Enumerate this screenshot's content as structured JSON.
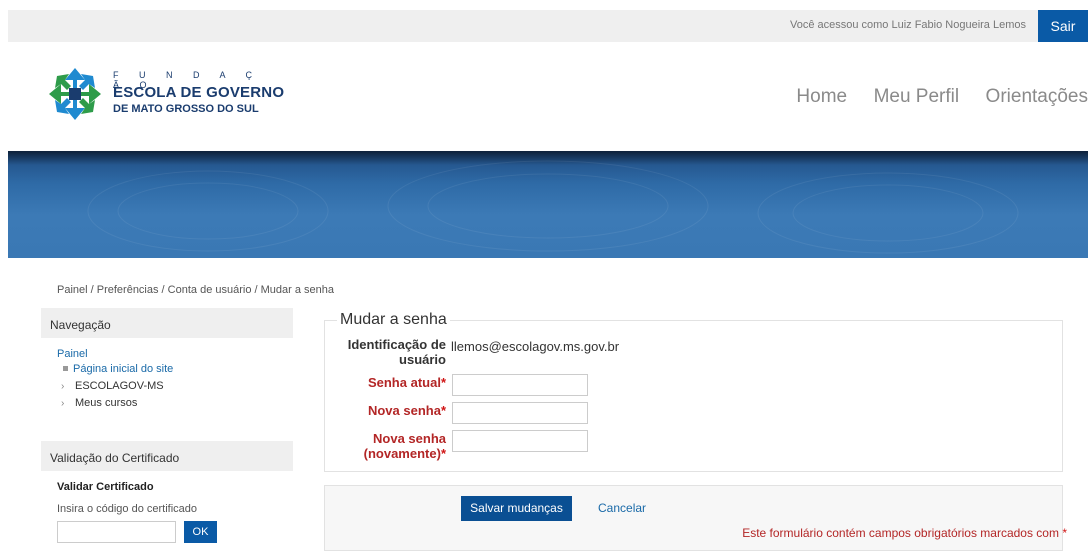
{
  "topbar": {
    "logged_in_text": "Você acessou como Luiz Fabio Nogueira Lemos",
    "logout_label": "Sair"
  },
  "logo": {
    "line_fundacao": "F U N D A Ç Ã O",
    "line1": "ESCOLA DE GOVERNO",
    "line2": "DE MATO GROSSO DO SUL",
    "colors": {
      "blue": "#1a3c6e",
      "green": "#2e9c4a",
      "lightblue": "#1f8ad0"
    }
  },
  "mainnav": {
    "items": [
      "Home",
      "Meu Perfil",
      "Orientações"
    ]
  },
  "breadcrumb": "Painel / Preferências / Conta de usuário / Mudar a senha",
  "navigation": {
    "title": "Navegação",
    "painel": "Painel",
    "items": [
      {
        "label": "Página inicial do site",
        "icon": "square-bullet-icon"
      },
      {
        "label": "ESCOLAGOV-MS",
        "icon": "chevron-right-icon"
      },
      {
        "label": "Meus cursos",
        "icon": "chevron-right-icon"
      }
    ]
  },
  "certificate": {
    "title": "Validação do Certificado",
    "subtitle": "Validar Certificado",
    "hint": "Insira o código do certificado",
    "code_value": "",
    "ok_label": "OK"
  },
  "form": {
    "legend": "Mudar a senha",
    "id_label": "Identificação de usuário",
    "id_value": "llemos@escolagov.ms.gov.br",
    "current_label": "Senha atual",
    "new_label": "Nova senha",
    "confirm_label": "Nova senha (novamente)",
    "required_mark": "*",
    "current_value": "",
    "new_value": "",
    "confirm_value": "",
    "save_label": "Salvar mudanças",
    "cancel_label": "Cancelar",
    "required_note": "Este formulário contém campos obrigatórios marcados com"
  },
  "colors": {
    "primary": "#0a5aa6",
    "required": "#b32626",
    "link": "#1a6aa8"
  }
}
